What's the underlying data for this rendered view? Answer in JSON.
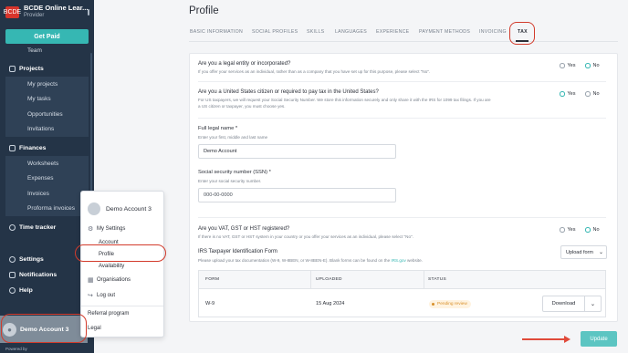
{
  "brand": {
    "logo_text": "BCDE",
    "name": "BCDE Online Lear...",
    "role": "Provider"
  },
  "sidebar": {
    "get_paid": "Get Paid",
    "team": "Team",
    "projects": {
      "label": "Projects",
      "items": [
        "My projects",
        "My tasks",
        "Opportunities",
        "Invitations"
      ]
    },
    "finances": {
      "label": "Finances",
      "items": [
        "Worksheets",
        "Expenses",
        "Invoices",
        "Proforma invoices"
      ]
    },
    "time_tracker": "Time tracker",
    "settings": "Settings",
    "notifications": "Notifications",
    "help": "Help",
    "account_name": "Demo Account 3",
    "powered": "Powered by"
  },
  "popup": {
    "account_name": "Demo Account 3",
    "my_settings": "My Settings",
    "account": "Account",
    "profile": "Profile",
    "availability": "Availability",
    "organisations": "Organisations",
    "logout": "Log out",
    "referral": "Referral program",
    "legal": "Legal"
  },
  "page": {
    "title": "Profile",
    "tabs": [
      "BASIC INFORMATION",
      "SOCIAL PROFILES",
      "SKILLS",
      "LANGUAGES",
      "EXPERIENCE",
      "PAYMENT METHODS",
      "INVOICING",
      "TAX"
    ],
    "active_tab": "TAX"
  },
  "tax": {
    "q1": "Are you a legal entity or incorporated?",
    "q1_help": "If you offer your services as an individual, rather than as a company that you have set up for this purpose, please select \"No\".",
    "q1_yes": "Yes",
    "q1_no": "No",
    "q2": "Are you a United States citizen or required to pay tax in the United States?",
    "q2_help1": "For US taxpayers, we will request your Social Security Number. We store this information securely and only share it with the IRS for 1099 tax filings. If you are",
    "q2_help2": "a US citizen or taxpayer, you must choose yes.",
    "q2_yes": "Yes",
    "q2_no": "No",
    "name_label": "Full legal name *",
    "name_help": "Enter your first, middle and last name",
    "name_value": "Demo Account",
    "ssn_label": "Social security number (SSN) *",
    "ssn_help": "Enter your social security number.",
    "ssn_placeholder": "000-00-0000",
    "q3": "Are you VAT, GST or HST registered?",
    "q3_help": "If there is no VAT, GST or HST system in your country or you offer your services as an individual, please select \"No\".",
    "q3_yes": "Yes",
    "q3_no": "No",
    "irs_label": "IRS Taxpayer Identification Form",
    "irs_help_pre": "Please upload your tax documentation (W-9, W-8BEN, or W-8BEN-E). Blank forms can be found on the",
    "irs_link": "IRS.gov",
    "irs_help_post": "website.",
    "upload_select": "Upload form",
    "table_headers": [
      "FORM",
      "UPLOADED",
      "STATUS"
    ],
    "row": {
      "form": "W-9",
      "uploaded": "15 Aug 2024",
      "status": "Pending review",
      "download": "Download"
    }
  },
  "update_button": "Update"
}
